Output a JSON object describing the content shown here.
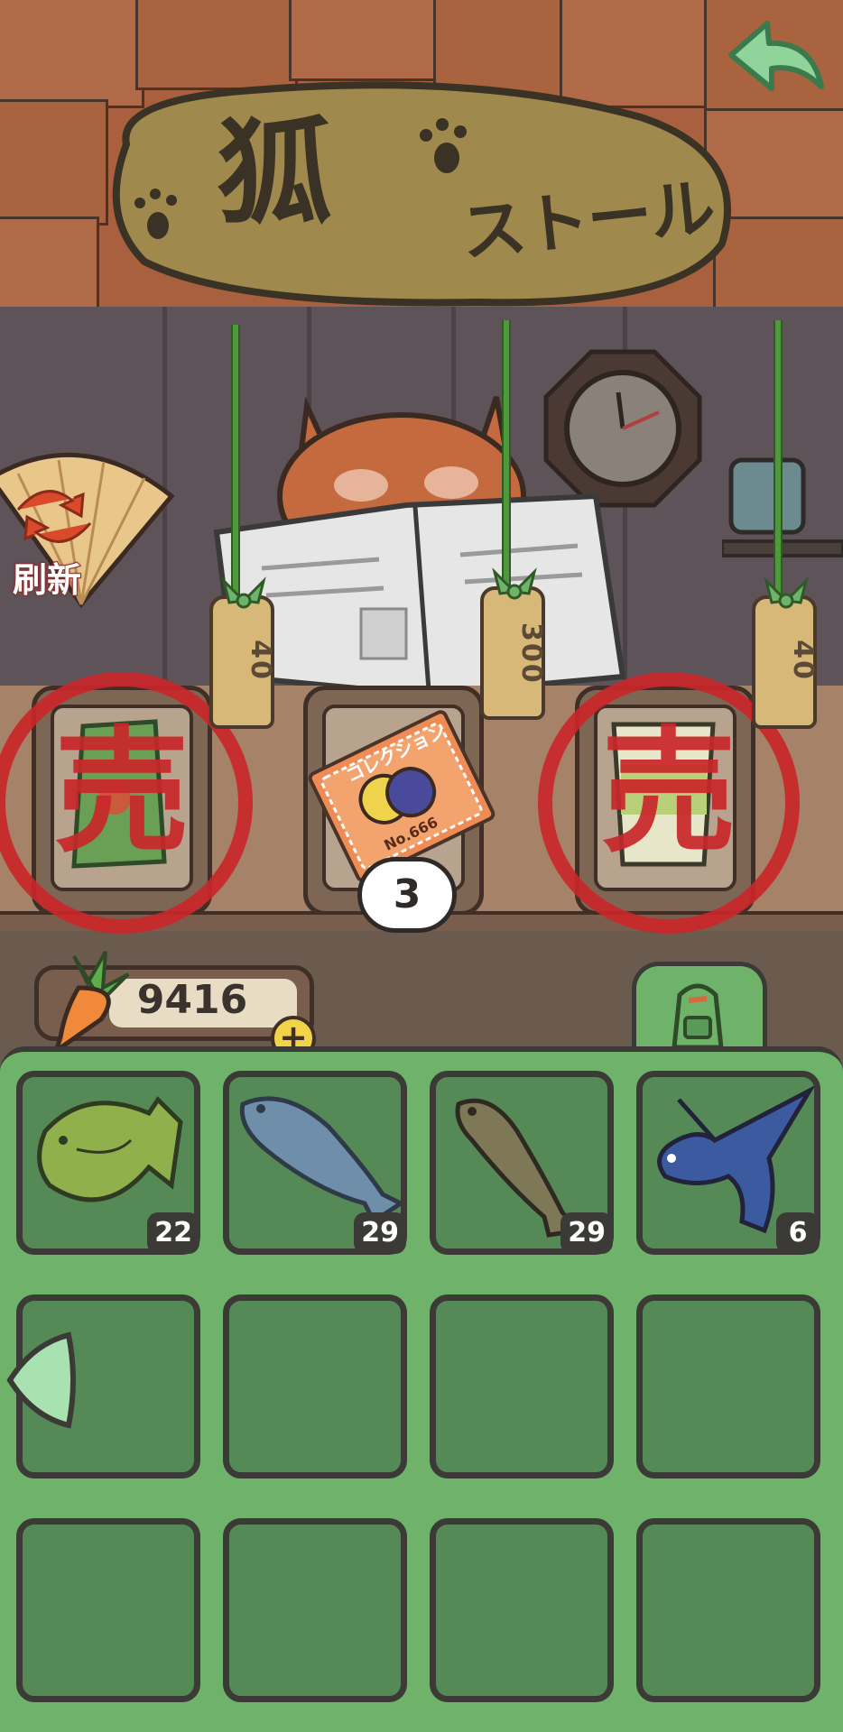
{
  "sign": {
    "title": "狐",
    "subtitle": "ストール"
  },
  "refresh_fan": {
    "label": "刷新"
  },
  "shop": {
    "slots": [
      {
        "item": "leaf-bag",
        "price_tag": "40",
        "sold": true,
        "sold_mark": "売"
      },
      {
        "item": "collection-ticket",
        "price_tag": "300",
        "sold": false,
        "ticket_text": "コレクション",
        "ticket_number": "No.666",
        "quantity": "3"
      },
      {
        "item": "cup-noodle",
        "price_tag": "40",
        "sold": true,
        "sold_mark": "売"
      }
    ]
  },
  "currency": {
    "value": "9416",
    "icon": "carrot-icon",
    "add_label": "+"
  },
  "inventory": {
    "tab_icon": "backpack-icon",
    "items": [
      {
        "name": "bluegill-fish",
        "count": "22"
      },
      {
        "name": "salmon-fish",
        "count": "29"
      },
      {
        "name": "catfish-fish",
        "count": "29"
      },
      {
        "name": "flying-fish",
        "count": "6"
      },
      {
        "name": "",
        "count": ""
      },
      {
        "name": "",
        "count": ""
      },
      {
        "name": "",
        "count": ""
      },
      {
        "name": "",
        "count": ""
      },
      {
        "name": "",
        "count": ""
      },
      {
        "name": "",
        "count": ""
      },
      {
        "name": "",
        "count": ""
      },
      {
        "name": "",
        "count": ""
      }
    ]
  },
  "colors": {
    "inventory_bg": "#6fb36b",
    "slot_bg": "#558a56",
    "sold_red": "#c9272a",
    "roof": "#a8603f"
  }
}
